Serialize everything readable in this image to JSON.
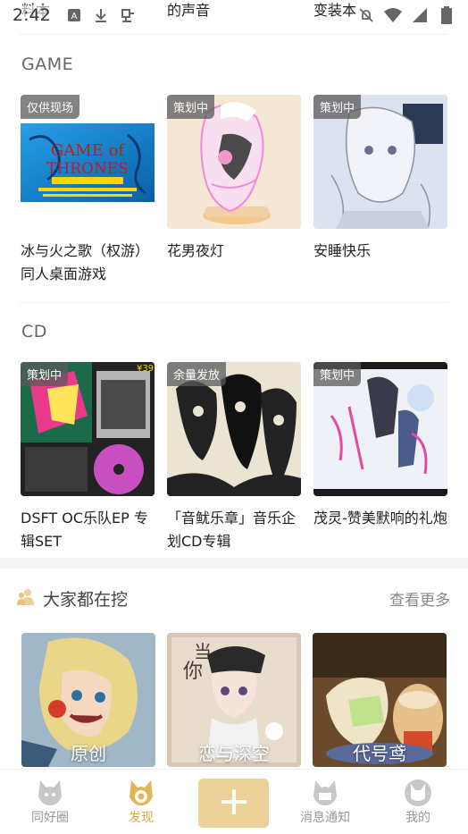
{
  "status_bar": {
    "time": "2:42"
  },
  "prev_row": {
    "col1": "料本",
    "col2": "的声音",
    "col3": "变装本"
  },
  "game_section": {
    "title": "GAME",
    "cards": [
      {
        "badge": "仅供现场",
        "title": "冰与火之歌（权游）同人桌面游戏"
      },
      {
        "badge": "策划中",
        "title": "花男夜灯"
      },
      {
        "badge": "策划中",
        "title": "安睡快乐"
      }
    ]
  },
  "cd_section": {
    "title": "CD",
    "cards": [
      {
        "badge": "策划中",
        "title": "DSFT OC乐队EP 专辑SET"
      },
      {
        "badge": "余量发放",
        "title": "「音鱿乐章」音乐企划CD专辑"
      },
      {
        "badge": "策划中",
        "title": "茂灵-赞美默响的礼炮"
      }
    ]
  },
  "dig_section": {
    "title": "大家都在挖",
    "more": "查看更多",
    "cards": [
      {
        "label": "原创"
      },
      {
        "label": "恋与深空"
      },
      {
        "label": "代号鸢"
      }
    ]
  },
  "bottom_nav": {
    "items": [
      {
        "label": "同好圈",
        "icon": "fox-friends-icon"
      },
      {
        "label": "发现",
        "icon": "fox-discover-icon",
        "active": true
      },
      {
        "label": "",
        "icon": "plus-icon"
      },
      {
        "label": "消息通知",
        "icon": "fox-message-icon"
      },
      {
        "label": "我的",
        "icon": "fox-profile-icon"
      }
    ]
  },
  "colors": {
    "accent": "#d6a949",
    "add_button": "#ecd298",
    "nav_inactive": "#999999"
  }
}
